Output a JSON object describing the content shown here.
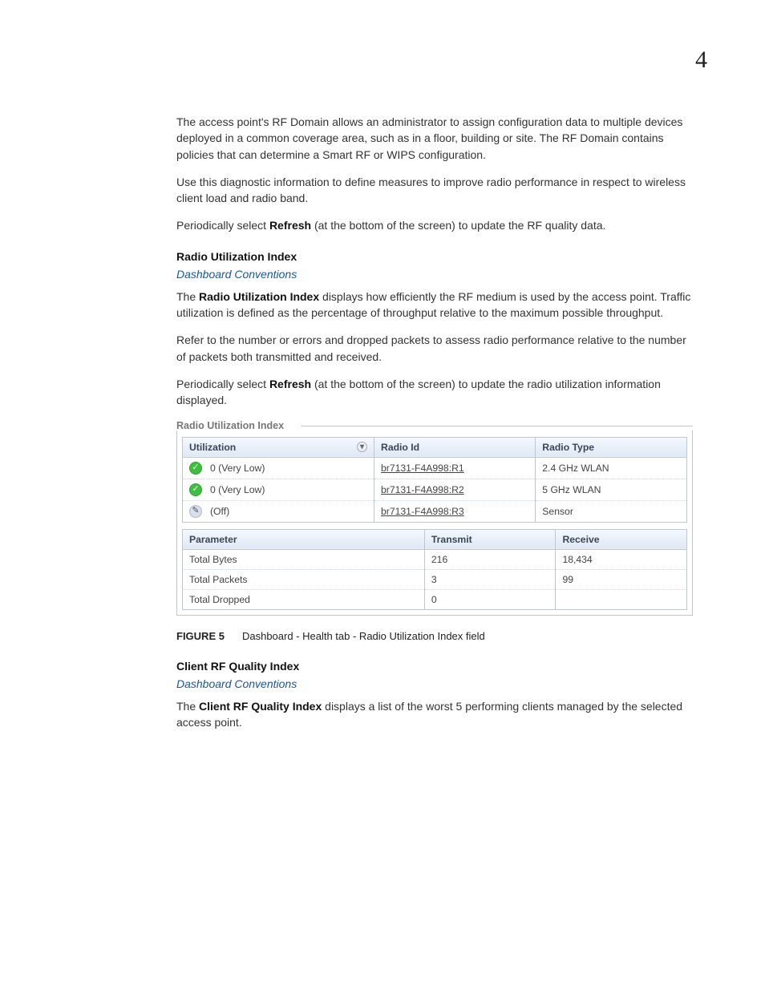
{
  "page_number": "4",
  "paragraphs": {
    "p1": "The access point's RF Domain allows an administrator to assign configuration data to multiple devices deployed in a common coverage area, such as in a floor, building or site. The RF Domain contains policies that can determine a Smart RF or WIPS configuration.",
    "p2": "Use this diagnostic information to define measures to improve radio performance in respect to wireless client load and radio band.",
    "p3_a": "Periodically select ",
    "p3_b": "Refresh",
    "p3_c": " (at the bottom of the screen) to update the RF quality data.",
    "sec1_title": "Radio Utilization Index",
    "link1": "Dashboard Conventions",
    "p4_a": "The ",
    "p4_b": "Radio Utilization Index",
    "p4_c": " displays how efficiently the RF medium is used by the access point. Traffic utilization is defined as the percentage of throughput relative to the maximum possible throughput.",
    "p5": "Refer to the number or errors and dropped packets to assess radio performance relative to the number of packets both transmitted and received.",
    "p6_a": "Periodically select ",
    "p6_b": "Refresh",
    "p6_c": " (at the bottom of the screen) to update the radio utilization information displayed."
  },
  "figure": {
    "field_label": "Radio Utilization Index",
    "table1": {
      "headers": {
        "h1": "Utilization",
        "h2": "Radio Id",
        "h3": "Radio Type"
      },
      "rows": [
        {
          "util": "0 (Very Low)",
          "dot": "green",
          "glyph": "✓",
          "radio": "br7131-F4A998:R1",
          "type": "2.4 GHz WLAN"
        },
        {
          "util": "0 (Very Low)",
          "dot": "green",
          "glyph": "✓",
          "radio": "br7131-F4A998:R2",
          "type": "5 GHz WLAN"
        },
        {
          "util": "(Off)",
          "dot": "gray",
          "glyph": "✎",
          "radio": "br7131-F4A998:R3",
          "type": "Sensor"
        }
      ]
    },
    "table2": {
      "headers": {
        "h1": "Parameter",
        "h2": "Transmit",
        "h3": "Receive"
      },
      "rows": [
        {
          "p": "Total Bytes",
          "t": "216",
          "r": "18,434"
        },
        {
          "p": "Total Packets",
          "t": "3",
          "r": "99"
        },
        {
          "p": "Total Dropped",
          "t": "0",
          "r": ""
        }
      ]
    },
    "caption_label": "FIGURE 5",
    "caption_text": "Dashboard - Health tab - Radio Utilization Index field"
  },
  "sec2": {
    "title": "Client RF Quality Index",
    "link": "Dashboard Conventions",
    "p_a": "The ",
    "p_b": "Client RF Quality Index",
    "p_c": " displays a list of the worst 5 performing clients managed by the selected access point."
  },
  "chart_data": [
    {
      "type": "table",
      "title": "Radio Utilization Index",
      "columns": [
        "Utilization",
        "Radio Id",
        "Radio Type"
      ],
      "rows": [
        [
          "0 (Very Low)",
          "br7131-F4A998:R1",
          "2.4 GHz WLAN"
        ],
        [
          "0 (Very Low)",
          "br7131-F4A998:R2",
          "5 GHz WLAN"
        ],
        [
          "(Off)",
          "br7131-F4A998:R3",
          "Sensor"
        ]
      ]
    },
    {
      "type": "table",
      "title": "Radio Utilization Totals",
      "columns": [
        "Parameter",
        "Transmit",
        "Receive"
      ],
      "rows": [
        [
          "Total Bytes",
          "216",
          "18,434"
        ],
        [
          "Total Packets",
          "3",
          "99"
        ],
        [
          "Total Dropped",
          "0",
          ""
        ]
      ]
    }
  ]
}
